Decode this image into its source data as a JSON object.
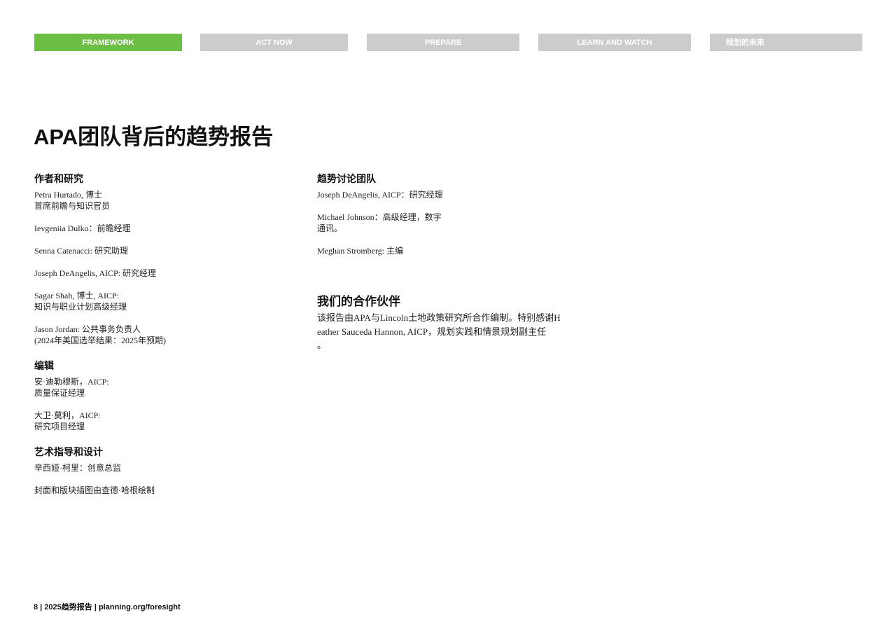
{
  "nav": {
    "tabs": [
      {
        "label": "FRAMEWORK",
        "active": true
      },
      {
        "label": "ACT NOW",
        "active": false
      },
      {
        "label": "PREPARE",
        "active": false
      },
      {
        "label": "LEARN AND WATCH",
        "active": false
      },
      {
        "label": "规划的未来",
        "active": false
      }
    ]
  },
  "page": {
    "title": "APA团队背后的趋势报告"
  },
  "authors": {
    "heading": "作者和研究",
    "entries": [
      {
        "lines": [
          "Petra Hurtado, 博士",
          "首席前瞻与知识官员"
        ]
      },
      {
        "lines": [
          "Ievgeniia Dulko：前瞻经理"
        ]
      },
      {
        "lines": [
          "Senna Catenacci: 研究助理"
        ]
      },
      {
        "lines": [
          "Joseph DeAngelis, AICP: 研究经理"
        ]
      },
      {
        "lines": [
          "Sagar Shah, 博士, AICP:",
          "知识与职业计划高级经理"
        ]
      },
      {
        "lines": [
          "Jason Jordan: 公共事务负责人",
          "(2024年美国选举结果：2025年预期)"
        ]
      }
    ]
  },
  "editors": {
    "heading": "编辑",
    "entries": [
      {
        "lines": [
          "安·迪勒穆斯，AICP:",
          "质量保证经理"
        ]
      },
      {
        "lines": [
          "大卫·莫利，AICP:",
          "研究项目经理"
        ]
      }
    ]
  },
  "design": {
    "heading": "艺术指导和设计",
    "entries": [
      {
        "lines": [
          "辛西娅·柯里：创意总监"
        ]
      },
      {
        "lines": [
          "封面和版块插图由查德·哈根绘制"
        ]
      }
    ]
  },
  "trend_team": {
    "heading": "趋势讨论团队",
    "entries": [
      {
        "lines": [
          "Joseph DeAngelis, AICP：研究经理"
        ]
      },
      {
        "lines": [
          "Michael Johnson：高级经理，数字",
          "通讯。"
        ]
      },
      {
        "lines": [
          "Meghan Stromberg: 主编"
        ]
      }
    ]
  },
  "partners": {
    "heading": "我们的合作伙伴",
    "lines": [
      "该报告由APA与Lincoln土地政策研究所合作编制。特别感谢H",
      "eather Sauceda Hannon, AICP，规划实践和情景规划副主任",
      "。"
    ]
  },
  "footer": {
    "text": "8 | 2025趋势报告 | planning.org/foresight"
  },
  "colors": {
    "active_tab": "#6dbe45",
    "inactive_tab": "#cccccc"
  }
}
